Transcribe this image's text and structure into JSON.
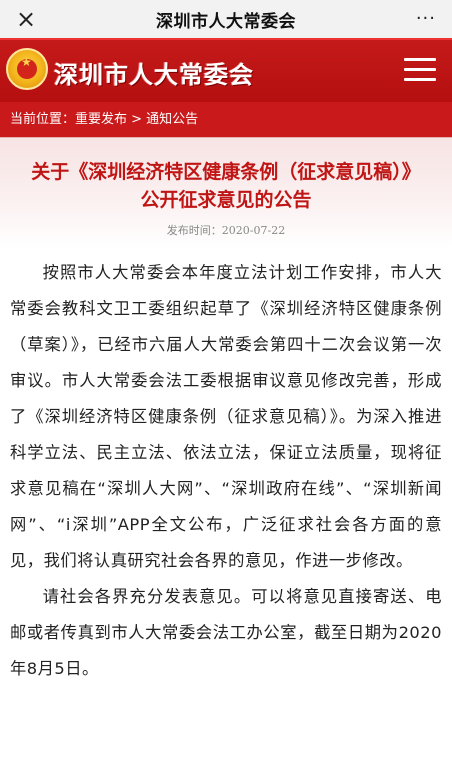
{
  "topbar": {
    "close": "×",
    "title": "深圳市人大常委会",
    "more": "···"
  },
  "header": {
    "site_name": "深圳市人大常委会",
    "emblem_icon": "national-emblem-icon",
    "menu_icon": "hamburger-menu-icon"
  },
  "breadcrumb": "当前位置：重要发布 > 通知公告",
  "article": {
    "title_line1": "关于《深圳经济特区健康条例（征求意见稿）》",
    "title_line2": "公开征求意见的公告",
    "date": "发布时间：2020-07-22",
    "paragraphs": [
      "按照市人大常委会本年度立法计划工作安排，市人大常委会教科文卫工委组织起草了《深圳经济特区健康条例（草案）》，已经市六届人大常委会第四十二次会议第一次审议。市人大常委会法工委根据审议意见修改完善，形成了《深圳经济特区健康条例（征求意见稿）》。为深入推进科学立法、民主立法、依法立法，保证立法质量，现将征求意见稿在“深圳人大网”、“深圳政府在线”、“深圳新闻网”、“i深圳”APP全文公布，广泛征求社会各方面的意见，我们将认真研究社会各界的意见，作进一步修改。",
      "请社会各界充分发表意见。可以将意见直接寄送、电邮或者传真到市人大常委会法工办公室，截至日期为2020年8月5日。"
    ]
  },
  "colors": {
    "brand_red": "#c51a1a",
    "title_red": "#c01515"
  }
}
